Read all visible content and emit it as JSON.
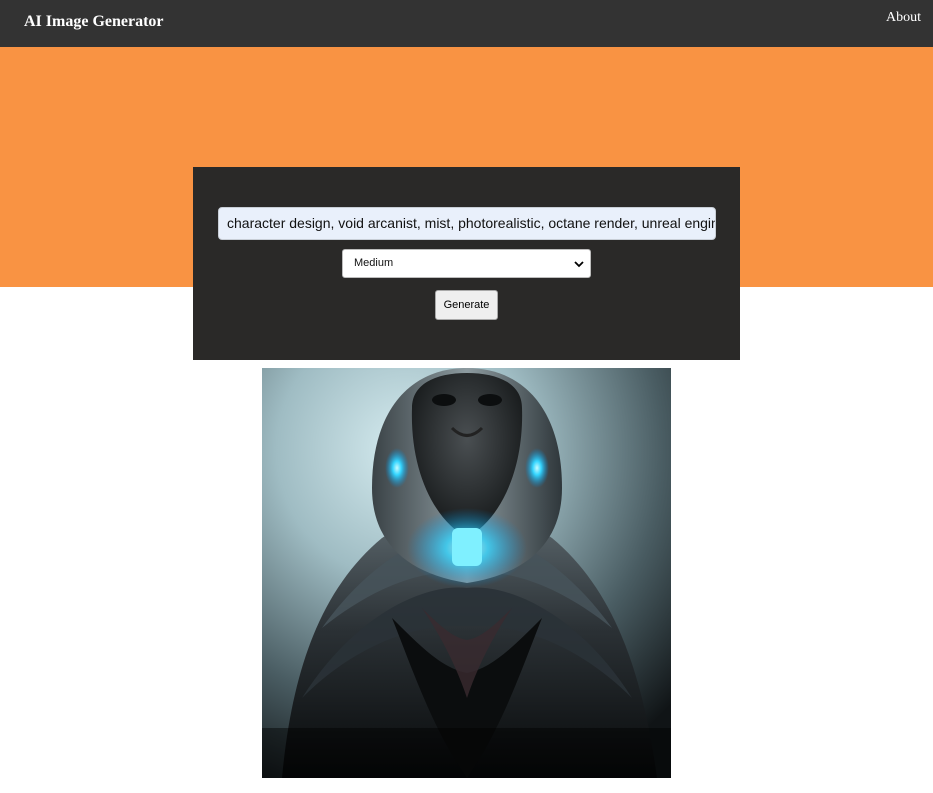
{
  "app": {
    "title": "AI Image Generator"
  },
  "nav": {
    "about_label": "About"
  },
  "form": {
    "prompt_value": "character design, void arcanist, mist, photorealistic, octane render, unreal engine, hyp",
    "size_selected": "Medium",
    "generate_label": "Generate"
  },
  "colors": {
    "navbar": "#333333",
    "hero": "#f99343",
    "panel": "#2a2928",
    "input_bg": "#e9f0fb"
  },
  "result": {
    "image_subject": "hooded-figure-image"
  }
}
